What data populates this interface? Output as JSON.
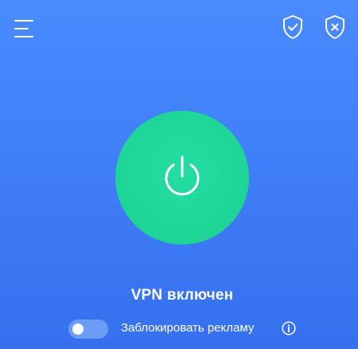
{
  "topbar": {
    "menu_icon": "hamburger-menu-icon",
    "shield_check_icon": "shield-check-icon",
    "shield_x_icon": "shield-x-icon"
  },
  "power": {
    "icon": "power-icon",
    "state": "on",
    "color": "#1fd699"
  },
  "status": {
    "text": "VPN включен"
  },
  "adblock": {
    "label": "Заблокировать рекламу",
    "enabled": false,
    "info_icon": "info-icon"
  },
  "colors": {
    "background_top": "#4a8bff",
    "background_bottom": "#3670ee",
    "power_button": "#1fd699",
    "toggle_off": "#6b9df7"
  }
}
